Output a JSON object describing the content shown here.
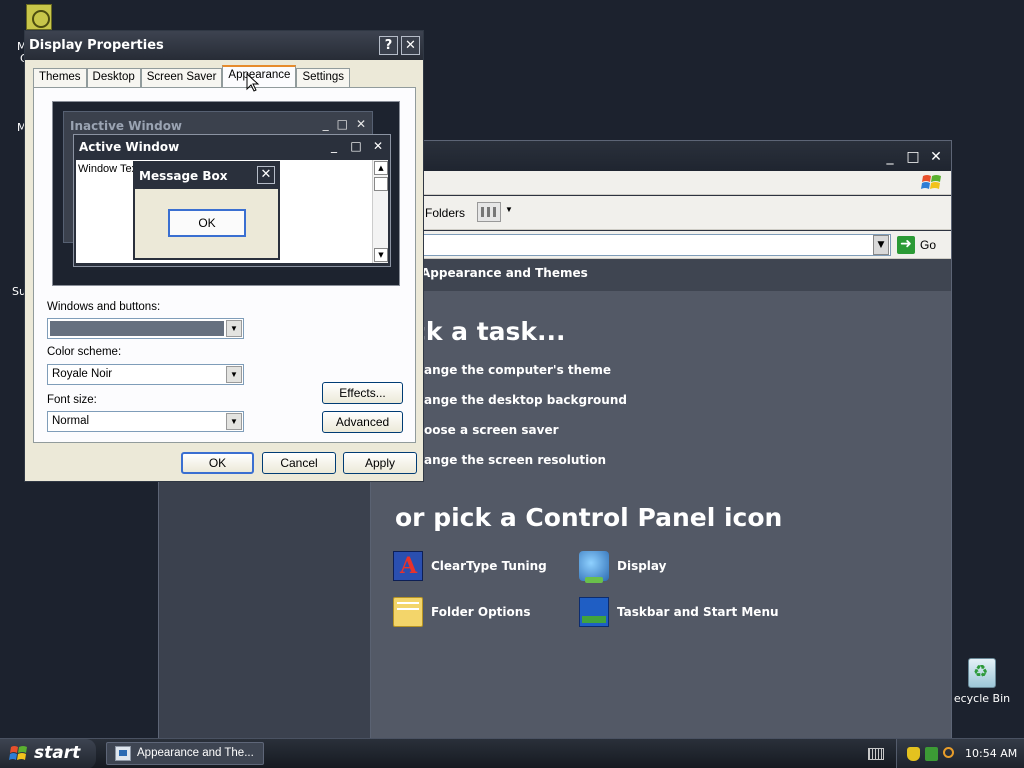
{
  "desktop": {
    "left_fragments": [
      "M",
      "C",
      "M",
      "Su"
    ],
    "recycle_bin_label": "ecycle Bin"
  },
  "control_panel": {
    "toolbar": {
      "folders_label": "Folders"
    },
    "address": {
      "go_label": "Go"
    },
    "breadcrumb": "Appearance and Themes",
    "pick_task_heading": "ck a task...",
    "tasks": [
      "ange the computer's theme",
      "ange the desktop background",
      "oose a screen saver",
      "ange the screen resolution"
    ],
    "pick_icon_heading": "or pick a Control Panel icon",
    "icons": [
      {
        "label": "ClearType Tuning",
        "icon": "cleartype-icon"
      },
      {
        "label": "Display",
        "icon": "display-icon"
      },
      {
        "label": "Folder Options",
        "icon": "folder-options-icon"
      },
      {
        "label": "Taskbar and Start Menu",
        "icon": "taskbar-icon"
      }
    ]
  },
  "display_properties": {
    "title": "Display Properties",
    "tabs": [
      "Themes",
      "Desktop",
      "Screen Saver",
      "Appearance",
      "Settings"
    ],
    "active_tab": "Appearance",
    "preview": {
      "inactive_title": "Inactive Window",
      "active_title": "Active Window",
      "window_text": "Window Text",
      "message_box_title": "Message Box",
      "message_box_ok": "OK"
    },
    "windows_and_buttons_label": "Windows and buttons:",
    "color_scheme_label": "Color scheme:",
    "color_scheme_value": "Royale Noir",
    "font_size_label": "Font size:",
    "font_size_value": "Normal",
    "effects_button": "Effects...",
    "advanced_button": "Advanced",
    "ok_button": "OK",
    "cancel_button": "Cancel",
    "apply_button": "Apply"
  },
  "taskbar": {
    "start_label": "start",
    "task_button_label": "Appearance and The...",
    "clock": "10:54 AM"
  },
  "colors": {
    "desktop": "#1c222e",
    "cp_main": "#535966",
    "dialog_face": "#ece9d8",
    "active_tab_accent": "#e68b2c"
  }
}
